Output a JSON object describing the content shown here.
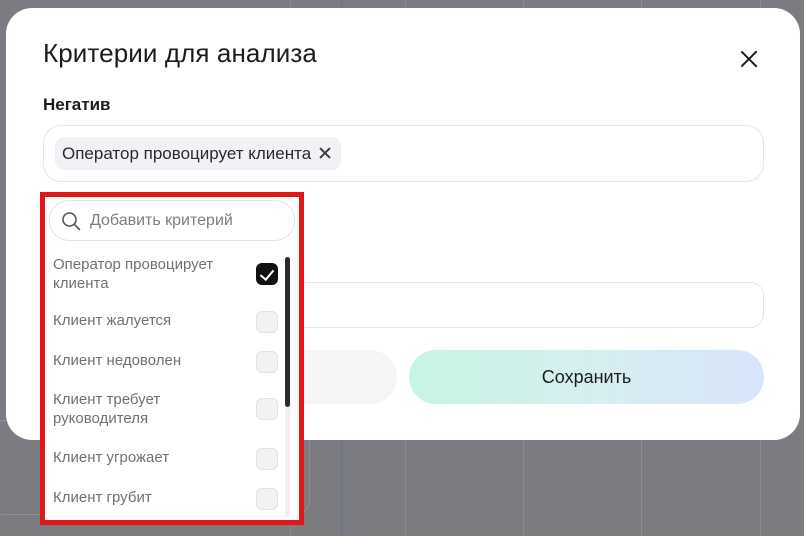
{
  "modal": {
    "title": "Критерии для анализа",
    "section_label": "Негатив",
    "selected_tags": [
      {
        "label": "Оператор провоцирует клиента"
      }
    ],
    "save_label": "Сохранить"
  },
  "dropdown": {
    "search_placeholder": "Добавить критерий",
    "options": [
      {
        "label": "Оператор провоцирует клиента",
        "checked": true
      },
      {
        "label": "Клиент жалуется",
        "checked": false
      },
      {
        "label": "Клиент недоволен",
        "checked": false
      },
      {
        "label": "Клиент требует руководителя",
        "checked": false
      },
      {
        "label": "Клиент угрожает",
        "checked": false
      },
      {
        "label": "Клиент грубит",
        "checked": false
      }
    ]
  },
  "colors": {
    "highlight_border": "#e01818",
    "overlay": "#7b7c81",
    "save_gradient_start": "#c8f5e4",
    "save_gradient_end": "#d8e4fb"
  }
}
